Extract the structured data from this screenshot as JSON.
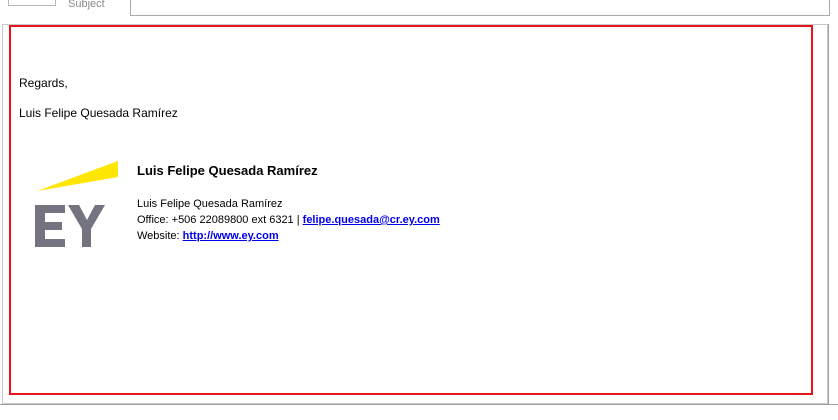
{
  "header": {
    "subject_label": "Subject"
  },
  "body": {
    "regards": "Regards,",
    "sender_name": "Luis Felipe Quesada Ramírez"
  },
  "signature": {
    "logo_text": "EY",
    "title_name": "Luis Felipe Quesada Ramírez",
    "name": "Luis Felipe Quesada Ramírez",
    "office_prefix": "Office: +506 22089800 ext 6321 | ",
    "email": "felipe.quesada@cr.ey.com",
    "website_prefix": "Website: ",
    "website": "http://www.ey.com"
  },
  "colors": {
    "highlight": "#e8141c",
    "ey_yellow": "#ffe600",
    "ey_gray": "#747480",
    "link": "#0000ee"
  }
}
